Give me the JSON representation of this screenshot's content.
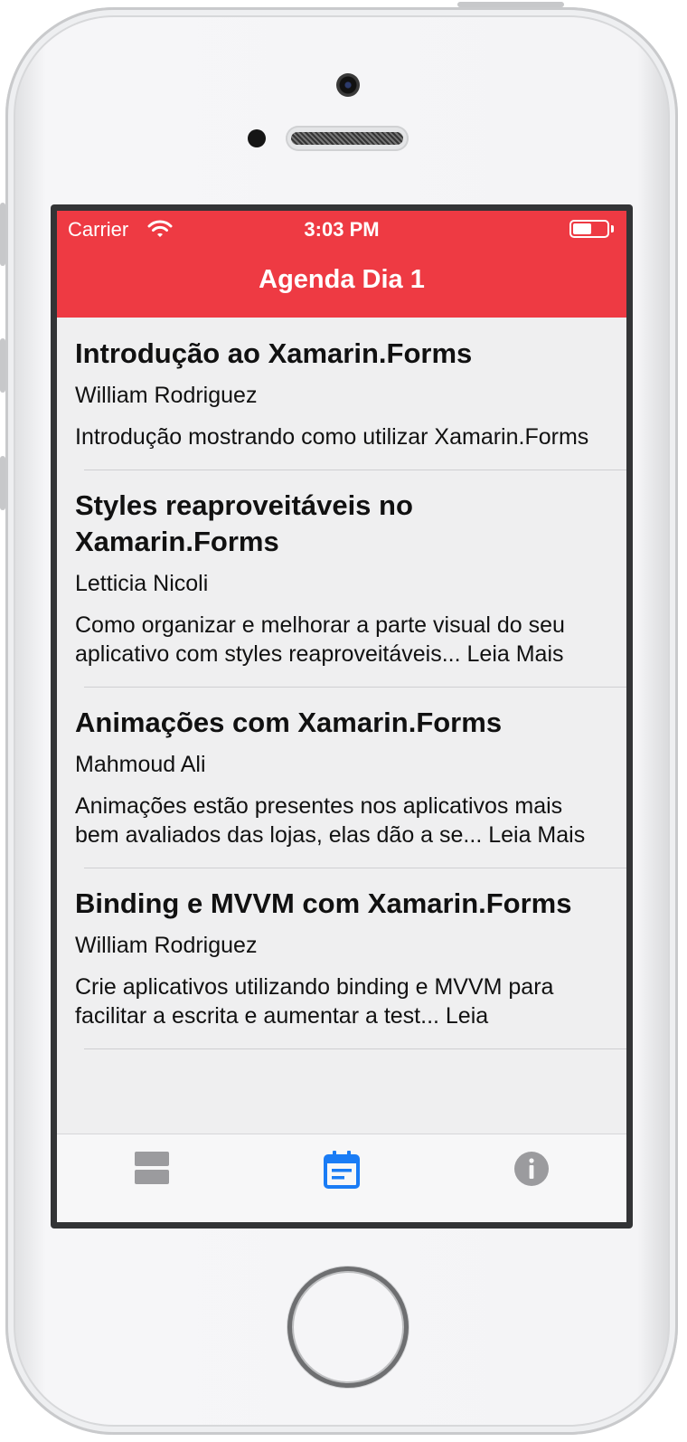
{
  "status_bar": {
    "carrier": "Carrier",
    "time": "3:03 PM"
  },
  "nav": {
    "title": "Agenda Dia 1",
    "accent_color": "#ee3a43"
  },
  "sessions": [
    {
      "title": "Introdução ao Xamarin.Forms",
      "speaker": "William Rodriguez",
      "description": "Introdução mostrando como utilizar Xamarin.Forms"
    },
    {
      "title": "Styles reaproveitáveis no Xamarin.Forms",
      "speaker": "Letticia Nicoli",
      "description": "Como organizar e melhorar a parte visual do seu aplicativo com styles reaproveitáveis... Leia Mais"
    },
    {
      "title": "Animações com Xamarin.Forms",
      "speaker": "Mahmoud Ali",
      "description": "Animações estão presentes nos aplicativos mais bem avaliados das lojas, elas dão a se... Leia Mais"
    },
    {
      "title": "Binding e MVVM com Xamarin.Forms",
      "speaker": "William Rodriguez",
      "description": "Crie aplicativos utilizando binding e MVVM para facilitar a escrita e aumentar a test... Leia"
    }
  ],
  "tabs": [
    {
      "icon": "list-icon",
      "active": false
    },
    {
      "icon": "calendar-icon",
      "active": true
    },
    {
      "icon": "info-icon",
      "active": false
    }
  ],
  "colors": {
    "tab_active": "#1a7cf5",
    "tab_inactive": "#9b9b9e"
  }
}
